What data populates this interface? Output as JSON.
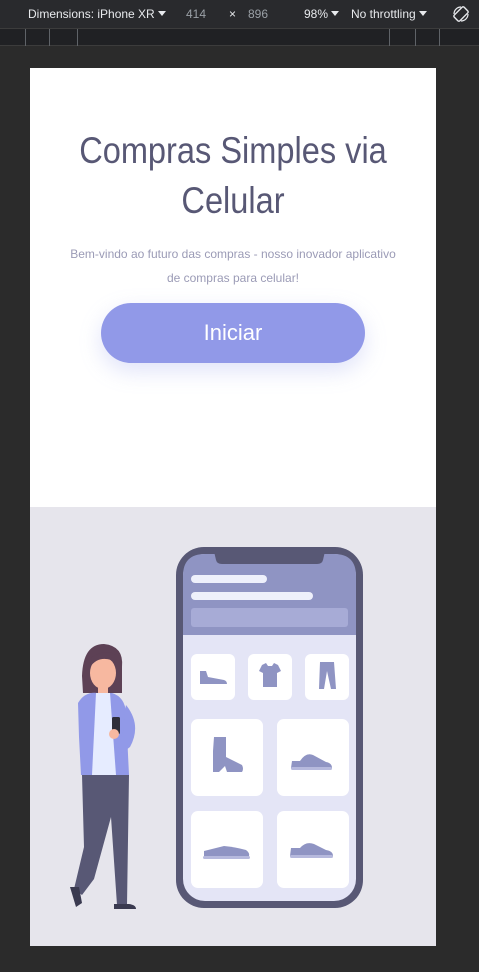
{
  "devtools": {
    "device_label": "Dimensions: iPhone XR",
    "width": "414",
    "times": "×",
    "height": "896",
    "zoom": "98%",
    "throttling": "No throttling"
  },
  "hero": {
    "title": "Compras Simples via Celular",
    "subtitle": "Bem-vindo ao futuro das compras - nosso inovador aplicativo de compras para celular!",
    "cta_label": "Iniciar"
  },
  "colors": {
    "accent": "#9199e8",
    "title": "#585875",
    "illustration_bg": "#e6e5ec",
    "phone_frame": "#585875"
  },
  "illustration": {
    "products": [
      "shoe-icon",
      "tshirt-icon",
      "pants-icon",
      "boot-icon",
      "sneaker-icon",
      "flat-shoe-icon",
      "sneaker-icon"
    ]
  }
}
